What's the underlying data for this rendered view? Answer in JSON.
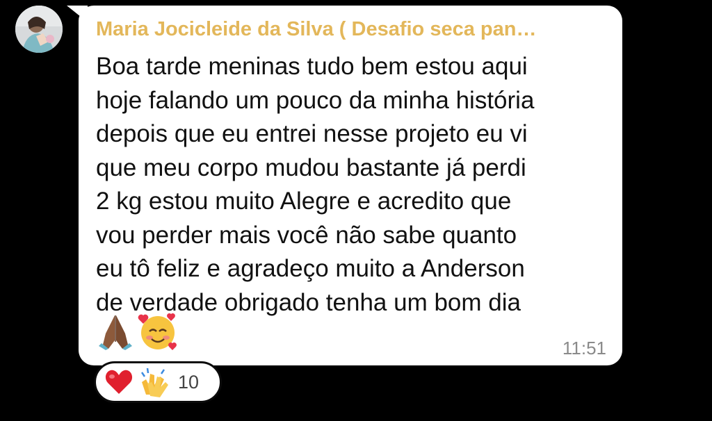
{
  "chat": {
    "sender_name": "Maria Jocicleide da Silva ( Desafio seca pan…",
    "message_text": "Boa tarde meninas tudo bem estou aqui\nhoje falando um pouco da minha história\ndepois que eu entrei nesse projeto eu vi\nque meu corpo mudou bastante já perdi\n2 kg estou muito Alegre e acredito que\nvou perder mais você não sabe quanto\neu tô feliz e agradeço muito a Anderson\nde verdade obrigado tenha um bom dia",
    "message_emojis": [
      "folded-hands-icon",
      "smiling-face-with-hearts-icon"
    ],
    "timestamp": "11:51"
  },
  "reactions": {
    "emojis": [
      "red-heart-icon",
      "clapping-hands-icon"
    ],
    "count": "10"
  },
  "colors": {
    "background": "#000000",
    "bubble": "#ffffff",
    "sender_name": "#e3b75a",
    "message_text": "#111111",
    "timestamp": "#8a8a8a"
  }
}
